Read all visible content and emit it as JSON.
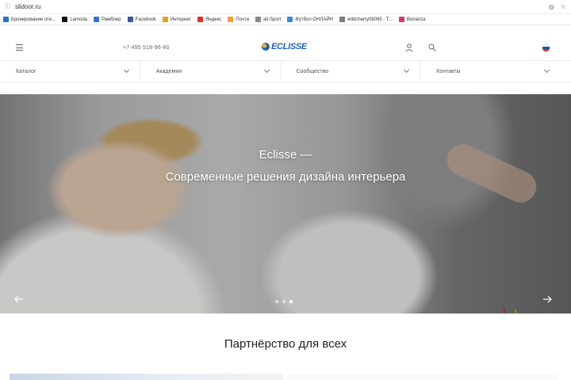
{
  "browser": {
    "url": "slidoor.ru",
    "bookmarks": [
      {
        "label": "Бронирование оте...",
        "color": "#2d6ec8"
      },
      {
        "label": "Lamoda",
        "color": "#111111"
      },
      {
        "label": "Рамблер",
        "color": "#3a6fd8"
      },
      {
        "label": "Facebook",
        "color": "#3b5998"
      },
      {
        "label": "Интернет",
        "color": "#e0a020"
      },
      {
        "label": "Яндекс",
        "color": "#e03030"
      },
      {
        "label": "Почта",
        "color": "#f0a030"
      },
      {
        "label": "all-Sport",
        "color": "#888888"
      },
      {
        "label": "Футбол ОНЛАЙН",
        "color": "#3a8ad8"
      },
      {
        "label": "wildcherry08095 - T...",
        "color": "#7a7a7a"
      },
      {
        "label": "Bonanza",
        "color": "#d04060"
      }
    ]
  },
  "header": {
    "phone": "+7 495 518-96-80",
    "logo_text": "ECLISSE",
    "language": "ru"
  },
  "nav": {
    "items": [
      {
        "label": "Каталог"
      },
      {
        "label": "Академия"
      },
      {
        "label": "Сообщество"
      },
      {
        "label": "Контакты"
      }
    ]
  },
  "hero": {
    "title_line1": "Eclisse —",
    "title_line2": "Современные решения дизайна интерьера",
    "slides_total": 3,
    "active_slide": 3
  },
  "section": {
    "title": "Партнёрство для всех"
  },
  "colors": {
    "brand_blue": "#1f5fb8",
    "brand_yellow": "#ffb400"
  }
}
